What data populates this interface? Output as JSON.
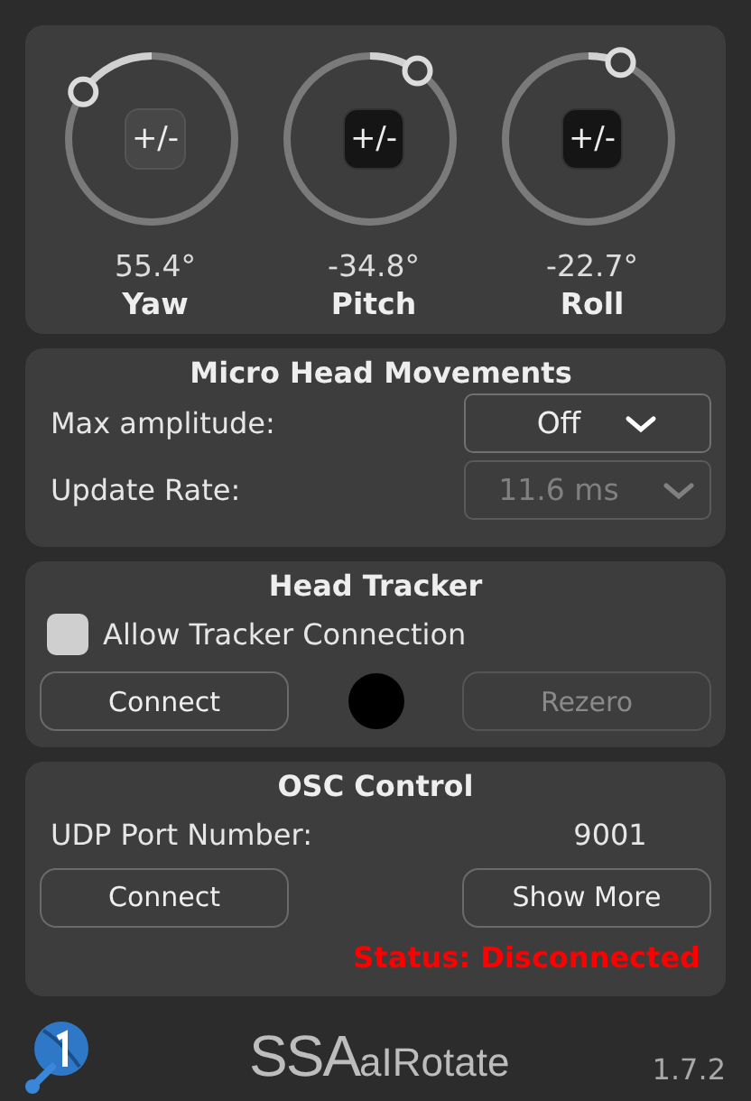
{
  "rotation": {
    "knobs": [
      {
        "value": "55.4°",
        "label": "Yaw",
        "button": "+/-",
        "inverted": false
      },
      {
        "value": "-34.8°",
        "label": "Pitch",
        "button": "+/-",
        "inverted": true
      },
      {
        "value": "-22.7°",
        "label": "Roll",
        "button": "+/-",
        "inverted": true
      }
    ]
  },
  "micro_head_movements": {
    "title": "Micro Head Movements",
    "rows": [
      {
        "label": "Max amplitude:",
        "value": "Off",
        "disabled": false
      },
      {
        "label": "Update Rate:",
        "value": "11.6 ms",
        "disabled": true
      }
    ]
  },
  "head_tracker": {
    "title": "Head Tracker",
    "checkbox": {
      "label": "Allow Tracker Connection",
      "checked": false
    },
    "connect_button": {
      "label": "Connect",
      "disabled": false
    },
    "connected": false,
    "rezero_button": {
      "label": "Rezero",
      "disabled": true
    }
  },
  "osc_control": {
    "title": "OSC Control",
    "port_label": "UDP Port Number:",
    "port_value": "9001",
    "buttons": [
      {
        "label": "Connect",
        "disabled": false
      },
      {
        "label": "Show More",
        "disabled": false
      }
    ],
    "status": "Status: Disconnected"
  },
  "footer": {
    "logo_main": "SSA",
    "logo_sub": "aIRotate",
    "version": "1.7.2"
  }
}
